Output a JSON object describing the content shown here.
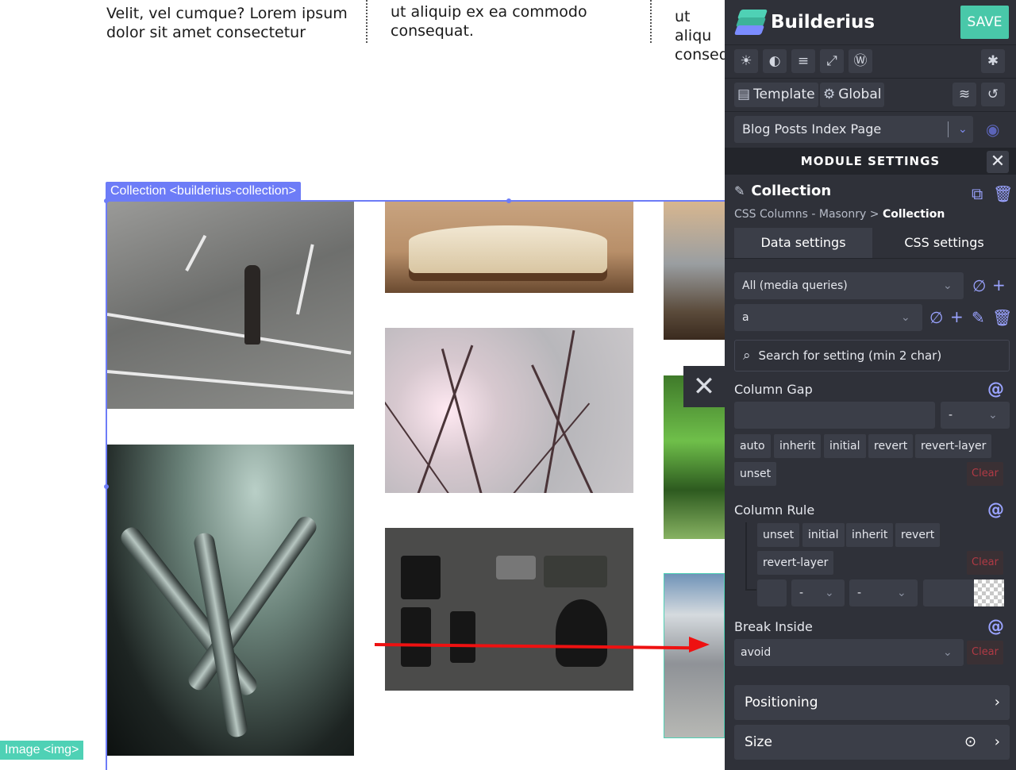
{
  "canvas": {
    "text_col_1": [
      "Velit, vel cumque? Lorem ipsum",
      "dolor sit amet consectetur"
    ],
    "text_col_2": [
      "ut aliquip ex ea commodo",
      "consequat."
    ],
    "text_col_3": [
      "ut aliqu",
      "conseq"
    ],
    "selection_label": "Collection <builderius-collection>",
    "hover_label": "Image <img>",
    "close_glyph": "✕"
  },
  "panel": {
    "brand": "Builderius",
    "save": "SAVE",
    "toolbar_icons": [
      "sun-icon",
      "contrast-icon",
      "align-icon",
      "expand-icon",
      "wordpress-icon",
      "bug-icon"
    ],
    "tab_template": "Template",
    "tab_global": "Global",
    "page_select": "Blog Posts Index Page",
    "module_settings": "MODULE SETTINGS",
    "module_title": "Collection",
    "breadcrumb_parent": "CSS Columns - Masonry",
    "breadcrumb_sep": ">",
    "breadcrumb_current": "Collection",
    "tab_data": "Data settings",
    "tab_css": "CSS settings",
    "media_query": "All (media queries)",
    "selector": "a",
    "search_placeholder": "Search for setting (min 2 char)",
    "column_gap": {
      "label": "Column Gap",
      "unit": "-",
      "chips": [
        "auto",
        "inherit",
        "initial",
        "revert",
        "revert-layer",
        "unset"
      ],
      "clear": "Clear"
    },
    "column_rule": {
      "label": "Column Rule",
      "chips": [
        "unset",
        "initial",
        "inherit",
        "revert",
        "revert-layer"
      ],
      "clear": "Clear",
      "style_value": "-",
      "unit_value": "-"
    },
    "break_inside": {
      "label": "Break Inside",
      "value": "avoid",
      "clear": "Clear"
    },
    "positioning": "Positioning",
    "size": "Size",
    "at_symbol": "@"
  },
  "colors": {
    "selection": "#6d7cf7",
    "accent": "#49c8a9",
    "panel_bg": "#2f3139",
    "arrow": "#ee1111"
  }
}
